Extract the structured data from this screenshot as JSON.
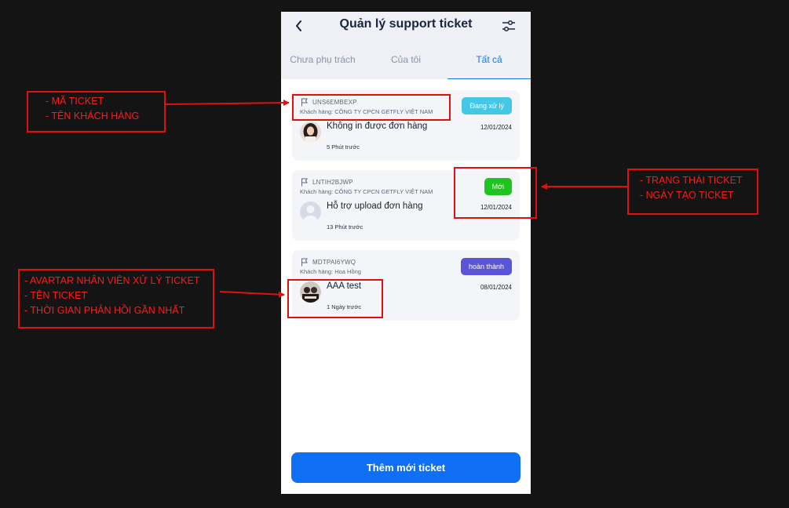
{
  "header": {
    "back_icon": "chevron-left-icon",
    "title": "Quản lý support ticket",
    "filter_icon": "sliders-icon"
  },
  "tabs": [
    {
      "label": "Chưa phụ trách",
      "active": false
    },
    {
      "label": "Của tôi",
      "active": false
    },
    {
      "label": "Tất cả",
      "active": true
    }
  ],
  "tickets": [
    {
      "code": "UNS6EMBEXP",
      "customer": "Khách hàng: CÔNG TY CPCN GETFLY VIỆT NAM",
      "status": "Đang xử lý",
      "status_color": "#45c7e8",
      "title": "Không in được đơn hàng",
      "date": "12/01/2024",
      "last_reply": "5 Phút trước"
    },
    {
      "code": "LNTIH2BJWP",
      "customer": "Khách hàng: CÔNG TY CPCN GETFLY VIỆT NAM",
      "status": "Mới",
      "status_color": "#1fc41f",
      "title": "Hỗ trợ  upload đơn hàng",
      "date": "12/01/2024",
      "last_reply": "13 Phút trước"
    },
    {
      "code": "MDTPAI6YWQ",
      "customer": "Khách hàng: Hoa Hồng",
      "status": "hoàn thành",
      "status_color": "#5a55d8",
      "title": "AAA test",
      "date": "08/01/2024",
      "last_reply": "1 Ngày trước"
    }
  ],
  "add_button": {
    "label": "Thêm mới ticket",
    "color": "#1070f5"
  },
  "annotations": {
    "code_customer": [
      "- MÃ TICKET",
      "- TÊN KHÁCH HÀNG"
    ],
    "status_date": [
      "- TRẠNG THÁI TICKET",
      "- NGÀY TẠO TICKET"
    ],
    "avatar_title_time": [
      "- AVARTAR NHÂN VIÊN XỬ LÝ TICKET",
      "- TÊN TICKET",
      "- THỜI GIAN PHẢN HỒI GẦN NHẤT"
    ],
    "color": "#e01010"
  }
}
